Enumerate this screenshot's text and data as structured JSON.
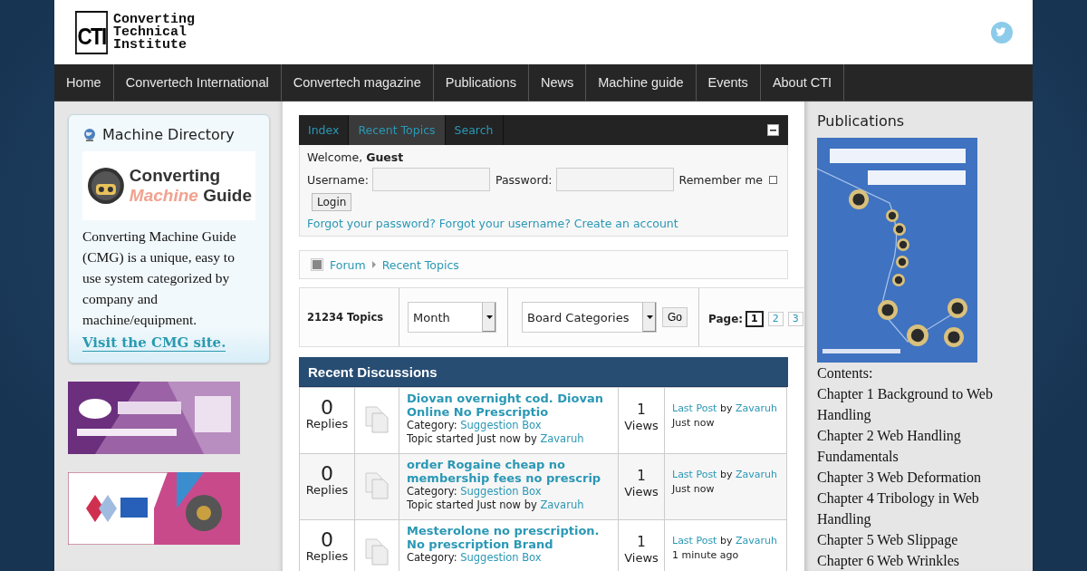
{
  "header": {
    "logo_mark": "CTI",
    "logo_lines": [
      "Converting",
      "Technical",
      "Institute"
    ]
  },
  "nav": [
    {
      "label": "Home"
    },
    {
      "label": "Convertech International"
    },
    {
      "label": "Convertech magazine"
    },
    {
      "label": "Publications"
    },
    {
      "label": "News"
    },
    {
      "label": "Machine guide"
    },
    {
      "label": "Events"
    },
    {
      "label": "About CTI"
    }
  ],
  "machine_directory": {
    "title": "Machine Directory",
    "logo_top": "Converting",
    "logo_accent": "Machine",
    "logo_rest": "Guide",
    "text": "Converting Machine Guide (CMG) is a unique, easy to use system categorized by company and machine/equipment.",
    "link": "Visit the CMG site."
  },
  "forum": {
    "tabs": [
      {
        "label": "Index",
        "selected": false
      },
      {
        "label": "Recent Topics",
        "selected": true
      },
      {
        "label": "Search",
        "selected": false
      }
    ],
    "login": {
      "welcome": "Welcome, **Guest**",
      "username_label": "Username:",
      "password_label": "Password:",
      "remember_label": "Remember me",
      "remember_checked": false,
      "button": "Login",
      "links": [
        "Forgot your password?",
        "Forgot your username?",
        "Create an account"
      ]
    },
    "breadcrumb": [
      "Forum",
      "Recent Topics"
    ],
    "filters": {
      "count": "21234 Topics",
      "period": "Month",
      "category": "Board Categories",
      "go": "Go",
      "page_label": "Page:",
      "pages": [
        {
          "label": "1",
          "selected": true
        },
        {
          "label": "2",
          "selected": false
        },
        {
          "label": "3",
          "selected": false
        }
      ]
    },
    "discussions": {
      "title": "Recent Discussions",
      "rows": [
        {
          "replies": "0",
          "replies_label": "Replies",
          "title": "Diovan overnight cod. Diovan Online No Prescriptio",
          "category_label": "Category:",
          "category": "Suggestion Box",
          "started": "Topic started Just now",
          "started_by": "by",
          "author": "Zavaruh",
          "views": "1",
          "views_label": "Views",
          "last_post": "Last Post",
          "last_by": "by",
          "last_author": "Zavaruh",
          "last_time": "Just now"
        },
        {
          "replies": "0",
          "replies_label": "Replies",
          "title": "order Rogaine cheap no membership fees no prescrip",
          "category_label": "Category:",
          "category": "Suggestion Box",
          "started": "Topic started Just now",
          "started_by": "by",
          "author": "Zavaruh",
          "views": "1",
          "views_label": "Views",
          "last_post": "Last Post",
          "last_by": "by",
          "last_author": "Zavaruh",
          "last_time": "Just now"
        },
        {
          "replies": "0",
          "replies_label": "Replies",
          "title": "Mesterolone no prescription. No prescription Brand",
          "category_label": "Category:",
          "category": "Suggestion Box",
          "views": "1",
          "views_label": "Views",
          "last_post": "Last Post",
          "last_by": "by",
          "last_author": "Zavaruh",
          "last_time": "1 minute ago"
        }
      ]
    }
  },
  "publications": {
    "title": "Publications",
    "contents_label": "Contents:",
    "chapters": [
      "Chapter 1 Background to Web Handling",
      "Chapter 2 Web Handling Fundamentals",
      "Chapter 3 Web Deformation",
      "Chapter 4 Tribology in Web Handling",
      "Chapter 5 Web Slippage",
      "Chapter 6 Web Wrinkles"
    ]
  }
}
